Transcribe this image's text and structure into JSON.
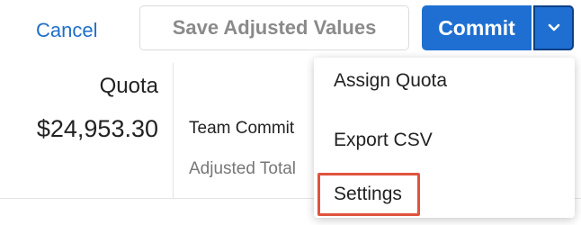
{
  "toolbar": {
    "cancel_label": "Cancel",
    "save_label": "Save Adjusted Values",
    "commit_label": "Commit",
    "caret_icon": "chevron-down-icon"
  },
  "summary": {
    "quota_label": "Quota",
    "quota_value": "$24,953.30",
    "team_commit_label": "Team Commit",
    "adjusted_total_label": "Adjusted Total",
    "partial_text": "…"
  },
  "dropdown": {
    "items": [
      {
        "label": "Assign Quota"
      },
      {
        "label": "Export CSV"
      },
      {
        "label": "Settings",
        "highlighted": true
      }
    ]
  },
  "colors": {
    "primary": "#1e6fd1",
    "link": "#1f6fc9",
    "highlight_border": "#e0533d"
  }
}
